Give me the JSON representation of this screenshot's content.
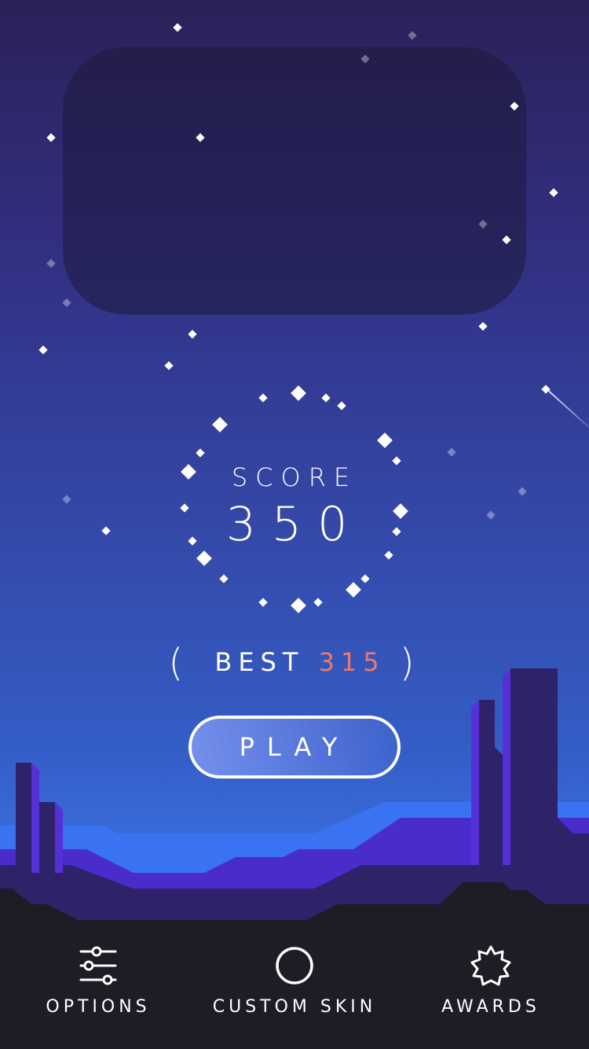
{
  "score": {
    "label": "SCORE",
    "value": "350"
  },
  "best": {
    "open_paren": "(",
    "label": "BEST",
    "value": "315",
    "close_paren": ")",
    "value_color": "#f07866"
  },
  "play_button": {
    "label": "PLAY"
  },
  "bottom_nav": [
    {
      "label": "OPTIONS",
      "icon": "sliders-icon"
    },
    {
      "label": "CUSTOM SKIN",
      "icon": "circle-icon"
    },
    {
      "label": "AWARDS",
      "icon": "badge-star-icon"
    }
  ],
  "colors": {
    "sky_top": "#2b2158",
    "sky_bottom": "#3a6fe0",
    "bottom_bar": "#1e1c24",
    "accent": "#f07866"
  }
}
